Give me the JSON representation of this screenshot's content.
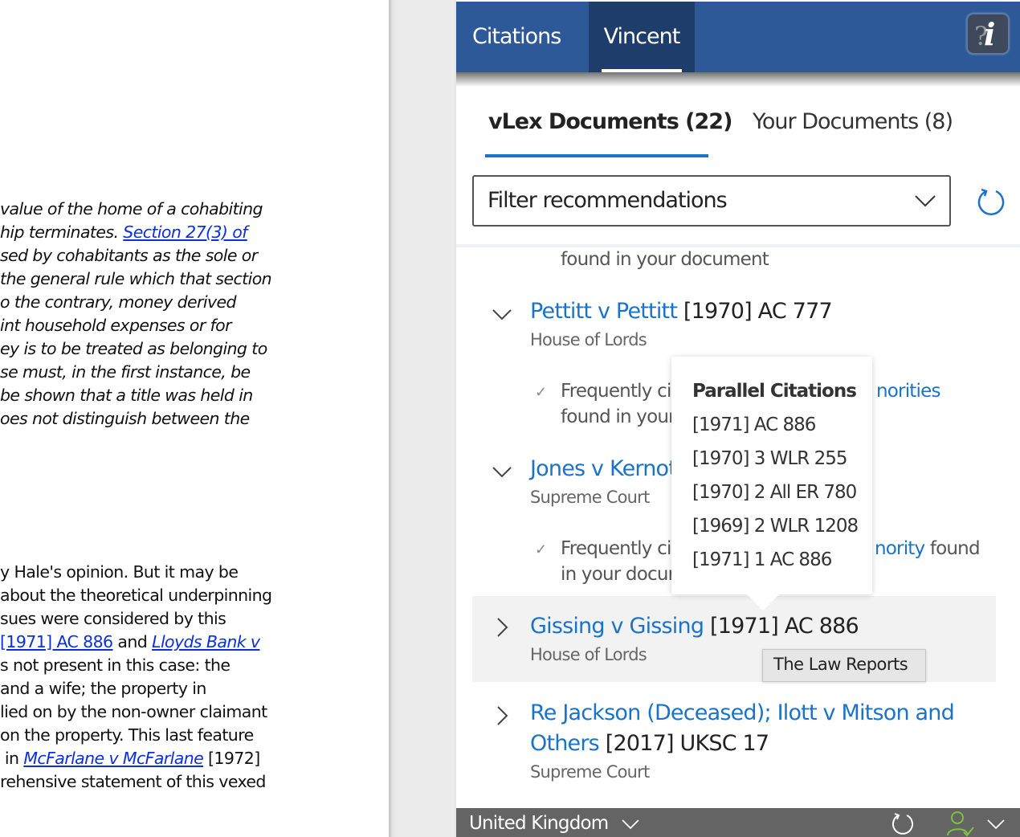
{
  "document": {
    "paragraph1_lines": [
      "value of the home of a cohabiting",
      "hip terminates. ",
      "sed by cohabitants as the sole or",
      "the general rule which that section",
      "o the contrary, money derived",
      "int household expenses or for",
      "ey is to be treated as belonging to",
      "se must, in the first instance, be",
      "be shown that a title was held in",
      "oes not distinguish between the"
    ],
    "paragraph1_link": "Section 27(3) of",
    "paragraph2": {
      "line1": "y Hale's opinion. But it may be",
      "line2": "about the theoretical underpinning",
      "line3": "sues were considered by this",
      "line4_link1": "[1971] AC 886",
      "line4_mid": " and ",
      "line4_link2": "Lloyds Bank v",
      "line5": "s not present in this case: the",
      "line6": "and a wife; the property in",
      "line7": "lied on by the non-owner claimant",
      "line8": "on the property. This last feature",
      "line9_pre": " in ",
      "line9_link": "McFarlane v McFarlane",
      "line9_post": " [1972]",
      "line10": "rehensive statement of this vexed"
    }
  },
  "panel": {
    "tabs": [
      {
        "label": "Citations",
        "active": false
      },
      {
        "label": "Vincent",
        "active": true
      }
    ],
    "info_icon": "help-info-icon",
    "subtabs": [
      {
        "label": "vLex Documents (22)",
        "active": true
      },
      {
        "label": "Your Documents (8)",
        "active": false
      }
    ],
    "filter": {
      "placeholder": "Filter recommendations"
    },
    "list": {
      "partial_top_text": "found in your document",
      "items": [
        {
          "title": "Pettitt v Pettitt",
          "citation": "[1970] AC 777",
          "court": "House of Lords",
          "expanded": true,
          "reason_prefix": "Frequently ci",
          "reason_link_tail": "norities",
          "reason_line2": "found in your"
        },
        {
          "title": "Jones v Kernot",
          "citation": "",
          "court": "Supreme Court",
          "expanded": true,
          "reason_prefix": "Frequently ci",
          "reason_link_tail": "nority",
          "reason_suffix": " found",
          "reason_line2": "in your docur"
        },
        {
          "title": "Gissing v Gissing",
          "citation": "[1971] AC 886",
          "court": "House of Lords",
          "expanded": false,
          "highlighted": true
        },
        {
          "title_line1": "Re Jackson (Deceased); Ilott v Mitson and",
          "title_line2": "Others",
          "citation": "[2017] UKSC 17",
          "court": "Supreme Court",
          "expanded": false
        }
      ]
    },
    "popover": {
      "title": "Parallel Citations",
      "items": [
        "[1971] AC 886",
        "[1970] 3 WLR 255",
        "[1970] 2 All ER 780",
        "[1969] 2 WLR 1208",
        "[1971] 1 AC 886"
      ]
    },
    "tooltip": "The Law Reports",
    "footer": {
      "region": "United Kingdom",
      "user_status_color": "#7dc242"
    },
    "colors": {
      "header": "#2d5998",
      "active_tab": "#1f3d6b",
      "accent": "#1a73c9",
      "footer": "#646464"
    }
  }
}
